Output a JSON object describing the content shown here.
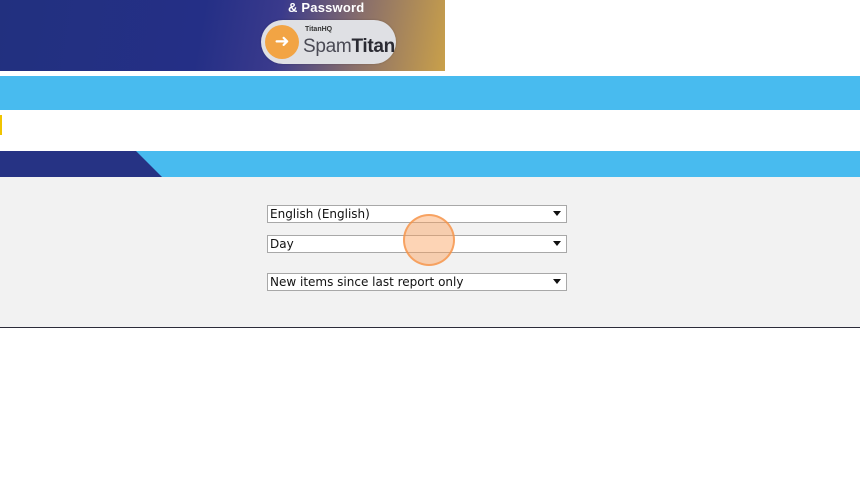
{
  "banner": {
    "tagline": "& Password",
    "logo_small": "TitanHQ",
    "logo_spam": "Spam",
    "logo_titan": "Titan",
    "logo_badge_icon": "runner-icon"
  },
  "colors": {
    "accent_blue": "#48bbef",
    "dark_blue": "#263384",
    "panel_bg": "#f2f2f2",
    "highlight_yellow": "#f0c400"
  },
  "settings": {
    "language": {
      "selected": "English (English)"
    },
    "frequency": {
      "selected": "Day"
    },
    "report_scope": {
      "selected": "New items since last report only"
    }
  }
}
